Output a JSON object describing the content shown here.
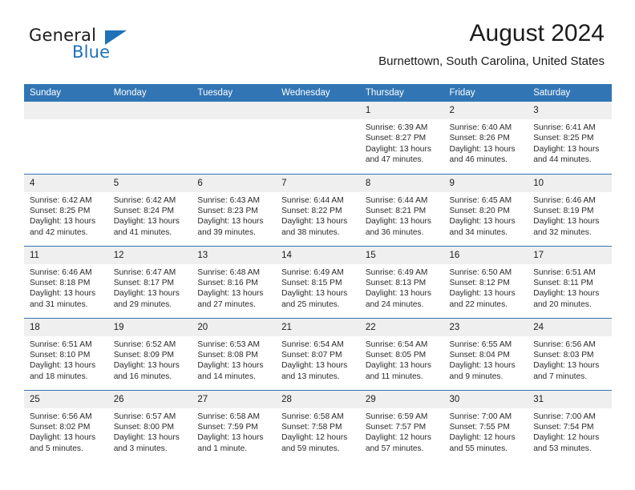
{
  "brand": {
    "name_part1": "General",
    "name_part2": "Blue",
    "accent_color": "#1f71b8"
  },
  "header": {
    "title": "August 2024",
    "location": "Burnettown, South Carolina, United States",
    "header_bg_color": "#3175b4",
    "daynum_bg_color": "#efefef"
  },
  "weekday_headers": [
    "Sunday",
    "Monday",
    "Tuesday",
    "Wednesday",
    "Thursday",
    "Friday",
    "Saturday"
  ],
  "weeks": [
    [
      {
        "day": "",
        "empty": true
      },
      {
        "day": "",
        "empty": true
      },
      {
        "day": "",
        "empty": true
      },
      {
        "day": "",
        "empty": true
      },
      {
        "day": "1",
        "sunrise": "Sunrise: 6:39 AM",
        "sunset": "Sunset: 8:27 PM",
        "daylight1": "Daylight: 13 hours",
        "daylight2": "and 47 minutes."
      },
      {
        "day": "2",
        "sunrise": "Sunrise: 6:40 AM",
        "sunset": "Sunset: 8:26 PM",
        "daylight1": "Daylight: 13 hours",
        "daylight2": "and 46 minutes."
      },
      {
        "day": "3",
        "sunrise": "Sunrise: 6:41 AM",
        "sunset": "Sunset: 8:25 PM",
        "daylight1": "Daylight: 13 hours",
        "daylight2": "and 44 minutes."
      }
    ],
    [
      {
        "day": "4",
        "sunrise": "Sunrise: 6:42 AM",
        "sunset": "Sunset: 8:25 PM",
        "daylight1": "Daylight: 13 hours",
        "daylight2": "and 42 minutes."
      },
      {
        "day": "5",
        "sunrise": "Sunrise: 6:42 AM",
        "sunset": "Sunset: 8:24 PM",
        "daylight1": "Daylight: 13 hours",
        "daylight2": "and 41 minutes."
      },
      {
        "day": "6",
        "sunrise": "Sunrise: 6:43 AM",
        "sunset": "Sunset: 8:23 PM",
        "daylight1": "Daylight: 13 hours",
        "daylight2": "and 39 minutes."
      },
      {
        "day": "7",
        "sunrise": "Sunrise: 6:44 AM",
        "sunset": "Sunset: 8:22 PM",
        "daylight1": "Daylight: 13 hours",
        "daylight2": "and 38 minutes."
      },
      {
        "day": "8",
        "sunrise": "Sunrise: 6:44 AM",
        "sunset": "Sunset: 8:21 PM",
        "daylight1": "Daylight: 13 hours",
        "daylight2": "and 36 minutes."
      },
      {
        "day": "9",
        "sunrise": "Sunrise: 6:45 AM",
        "sunset": "Sunset: 8:20 PM",
        "daylight1": "Daylight: 13 hours",
        "daylight2": "and 34 minutes."
      },
      {
        "day": "10",
        "sunrise": "Sunrise: 6:46 AM",
        "sunset": "Sunset: 8:19 PM",
        "daylight1": "Daylight: 13 hours",
        "daylight2": "and 32 minutes."
      }
    ],
    [
      {
        "day": "11",
        "sunrise": "Sunrise: 6:46 AM",
        "sunset": "Sunset: 8:18 PM",
        "daylight1": "Daylight: 13 hours",
        "daylight2": "and 31 minutes."
      },
      {
        "day": "12",
        "sunrise": "Sunrise: 6:47 AM",
        "sunset": "Sunset: 8:17 PM",
        "daylight1": "Daylight: 13 hours",
        "daylight2": "and 29 minutes."
      },
      {
        "day": "13",
        "sunrise": "Sunrise: 6:48 AM",
        "sunset": "Sunset: 8:16 PM",
        "daylight1": "Daylight: 13 hours",
        "daylight2": "and 27 minutes."
      },
      {
        "day": "14",
        "sunrise": "Sunrise: 6:49 AM",
        "sunset": "Sunset: 8:15 PM",
        "daylight1": "Daylight: 13 hours",
        "daylight2": "and 25 minutes."
      },
      {
        "day": "15",
        "sunrise": "Sunrise: 6:49 AM",
        "sunset": "Sunset: 8:13 PM",
        "daylight1": "Daylight: 13 hours",
        "daylight2": "and 24 minutes."
      },
      {
        "day": "16",
        "sunrise": "Sunrise: 6:50 AM",
        "sunset": "Sunset: 8:12 PM",
        "daylight1": "Daylight: 13 hours",
        "daylight2": "and 22 minutes."
      },
      {
        "day": "17",
        "sunrise": "Sunrise: 6:51 AM",
        "sunset": "Sunset: 8:11 PM",
        "daylight1": "Daylight: 13 hours",
        "daylight2": "and 20 minutes."
      }
    ],
    [
      {
        "day": "18",
        "sunrise": "Sunrise: 6:51 AM",
        "sunset": "Sunset: 8:10 PM",
        "daylight1": "Daylight: 13 hours",
        "daylight2": "and 18 minutes."
      },
      {
        "day": "19",
        "sunrise": "Sunrise: 6:52 AM",
        "sunset": "Sunset: 8:09 PM",
        "daylight1": "Daylight: 13 hours",
        "daylight2": "and 16 minutes."
      },
      {
        "day": "20",
        "sunrise": "Sunrise: 6:53 AM",
        "sunset": "Sunset: 8:08 PM",
        "daylight1": "Daylight: 13 hours",
        "daylight2": "and 14 minutes."
      },
      {
        "day": "21",
        "sunrise": "Sunrise: 6:54 AM",
        "sunset": "Sunset: 8:07 PM",
        "daylight1": "Daylight: 13 hours",
        "daylight2": "and 13 minutes."
      },
      {
        "day": "22",
        "sunrise": "Sunrise: 6:54 AM",
        "sunset": "Sunset: 8:05 PM",
        "daylight1": "Daylight: 13 hours",
        "daylight2": "and 11 minutes."
      },
      {
        "day": "23",
        "sunrise": "Sunrise: 6:55 AM",
        "sunset": "Sunset: 8:04 PM",
        "daylight1": "Daylight: 13 hours",
        "daylight2": "and 9 minutes."
      },
      {
        "day": "24",
        "sunrise": "Sunrise: 6:56 AM",
        "sunset": "Sunset: 8:03 PM",
        "daylight1": "Daylight: 13 hours",
        "daylight2": "and 7 minutes."
      }
    ],
    [
      {
        "day": "25",
        "sunrise": "Sunrise: 6:56 AM",
        "sunset": "Sunset: 8:02 PM",
        "daylight1": "Daylight: 13 hours",
        "daylight2": "and 5 minutes."
      },
      {
        "day": "26",
        "sunrise": "Sunrise: 6:57 AM",
        "sunset": "Sunset: 8:00 PM",
        "daylight1": "Daylight: 13 hours",
        "daylight2": "and 3 minutes."
      },
      {
        "day": "27",
        "sunrise": "Sunrise: 6:58 AM",
        "sunset": "Sunset: 7:59 PM",
        "daylight1": "Daylight: 13 hours",
        "daylight2": "and 1 minute."
      },
      {
        "day": "28",
        "sunrise": "Sunrise: 6:58 AM",
        "sunset": "Sunset: 7:58 PM",
        "daylight1": "Daylight: 12 hours",
        "daylight2": "and 59 minutes."
      },
      {
        "day": "29",
        "sunrise": "Sunrise: 6:59 AM",
        "sunset": "Sunset: 7:57 PM",
        "daylight1": "Daylight: 12 hours",
        "daylight2": "and 57 minutes."
      },
      {
        "day": "30",
        "sunrise": "Sunrise: 7:00 AM",
        "sunset": "Sunset: 7:55 PM",
        "daylight1": "Daylight: 12 hours",
        "daylight2": "and 55 minutes."
      },
      {
        "day": "31",
        "sunrise": "Sunrise: 7:00 AM",
        "sunset": "Sunset: 7:54 PM",
        "daylight1": "Daylight: 12 hours",
        "daylight2": "and 53 minutes."
      }
    ]
  ]
}
